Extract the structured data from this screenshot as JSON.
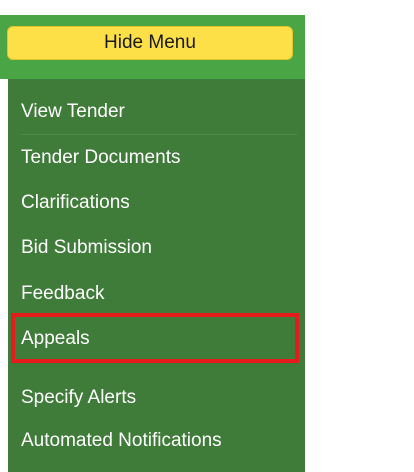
{
  "header": {
    "hide_menu_label": "Hide Menu"
  },
  "menu": {
    "items": [
      {
        "label": "View Tender"
      },
      {
        "label": "Tender Documents"
      },
      {
        "label": "Clarifications"
      },
      {
        "label": "Bid Submission"
      },
      {
        "label": "Feedback"
      },
      {
        "label": "Appeals",
        "selected": true
      },
      {
        "label": "Specify Alerts"
      },
      {
        "label": "Automated Notifications"
      }
    ]
  },
  "colors": {
    "header_green": "#4aa544",
    "panel_green": "#3f7b39",
    "button_yellow": "#fde047",
    "highlight_red": "#e61b1b"
  }
}
